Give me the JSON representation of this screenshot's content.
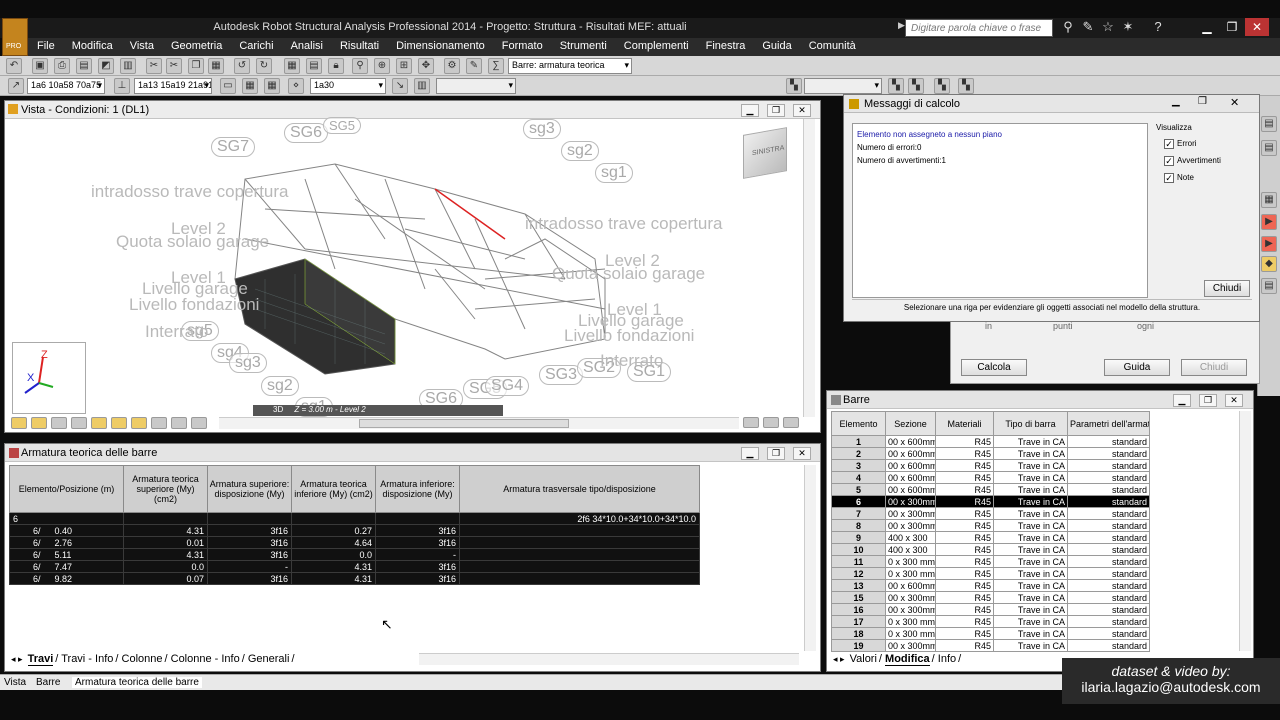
{
  "app": {
    "title": "Autodesk Robot Structural Analysis Professional 2014 - Progetto: Struttura - Risultati MEF: attuali",
    "search_placeholder": "Digitare parola chiave o frase",
    "logo_text": "PRO"
  },
  "menu": [
    "File",
    "Modifica",
    "Vista",
    "Geometria",
    "Carichi",
    "Analisi",
    "Risultati",
    "Dimensionamento",
    "Formato",
    "Strumenti",
    "Complementi",
    "Finestra",
    "Guida",
    "Comunità"
  ],
  "toolbar": {
    "combo_barre": "Barre: armatura teorica",
    "combo_a": "1a6 10a58 70a75 7",
    "combo_b": "1a13 15a19 21a91",
    "combo_c": "1a30"
  },
  "view3d": {
    "title": "Vista - Condizioni: 1 (DL1)",
    "bottom_mode": "3D",
    "bottom_info": "Z = 3.00 m - Level 2",
    "nav_cube": "SINISTRA",
    "labels": [
      "intradosso trave copertura",
      "Level 2",
      "Quota solaio garage",
      "Level 1",
      "Livello garage",
      "Livello fondazioni",
      "Interrato",
      "intradosso trave copertura",
      "Level 2",
      "Quota solaio garage",
      "Level 1",
      "Livello garage",
      "Livello fondazioni",
      "Interrato"
    ],
    "gridpills": [
      "SG7",
      "SG6",
      "SG5",
      "sg3",
      "sg2",
      "sg1",
      "sg5",
      "sg4",
      "sg3",
      "sg2",
      "sg1",
      "SG6",
      "SG5",
      "SG4",
      "SG3",
      "SG2",
      "SG1"
    ]
  },
  "armatura": {
    "title": "Armatura teorica delle barre",
    "headers": [
      "Elemento/Posizione (m)",
      "Armatura teorica superiore (My) (cm2)",
      "Armatura superiore: disposizione (My)",
      "Armatura teorica inferiore (My) (cm2)",
      "Armatura inferiore: disposizione (My)",
      "Armatura trasversale tipo/disposizione"
    ],
    "group_row": {
      "elem": "6",
      "trasv": "2f6 34*10.0+34*10.0+34*10.0"
    },
    "rows": [
      {
        "e": "6/",
        "p": "0.40",
        "s": "4.31",
        "sd": "3f16",
        "i": "0.27",
        "id": "3f16"
      },
      {
        "e": "6/",
        "p": "2.76",
        "s": "0.01",
        "sd": "3f16",
        "i": "4.64",
        "id": "3f16"
      },
      {
        "e": "6/",
        "p": "5.11",
        "s": "4.31",
        "sd": "3f16",
        "i": "0.0",
        "id": "-"
      },
      {
        "e": "6/",
        "p": "7.47",
        "s": "0.0",
        "sd": "-",
        "i": "4.31",
        "id": "3f16"
      },
      {
        "e": "6/",
        "p": "9.82",
        "s": "0.07",
        "sd": "3f16",
        "i": "4.31",
        "id": "3f16"
      }
    ],
    "tabs": [
      "Travi",
      "Travi - Info",
      "Colonne",
      "Colonne - Info",
      "Generali"
    ]
  },
  "barre": {
    "title": "Barre",
    "headers": [
      "Elemento",
      "Sezione",
      "Materiali",
      "Tipo di barra",
      "Parametri dell'armatura"
    ],
    "rows": [
      [
        "1",
        "00 x 600mm",
        "R45",
        "Trave in CA",
        "standard"
      ],
      [
        "2",
        "00 x 600mm",
        "R45",
        "Trave in CA",
        "standard"
      ],
      [
        "3",
        "00 x 600mm",
        "R45",
        "Trave in CA",
        "standard"
      ],
      [
        "4",
        "00 x 600mm",
        "R45",
        "Trave in CA",
        "standard"
      ],
      [
        "5",
        "00 x 600mm",
        "R45",
        "Trave in CA",
        "standard"
      ],
      [
        "6",
        "00 x 300mm",
        "R45",
        "Trave in CA",
        "standard"
      ],
      [
        "7",
        "00 x 300mm",
        "R45",
        "Trave in CA",
        "standard"
      ],
      [
        "8",
        "00 x 300mm",
        "R45",
        "Trave in CA",
        "standard"
      ],
      [
        "9",
        "400 x 300",
        "R45",
        "Trave in CA",
        "standard"
      ],
      [
        "10",
        "400 x 300",
        "R45",
        "Trave in CA",
        "standard"
      ],
      [
        "11",
        "0 x 300 mm",
        "R45",
        "Trave in CA",
        "standard"
      ],
      [
        "12",
        "0 x 300 mm",
        "R45",
        "Trave in CA",
        "standard"
      ],
      [
        "13",
        "00 x 600mm",
        "R45",
        "Trave in CA",
        "standard"
      ],
      [
        "15",
        "00 x 300mm",
        "R45",
        "Trave in CA",
        "standard"
      ],
      [
        "16",
        "00 x 300mm",
        "R45",
        "Trave in CA",
        "standard"
      ],
      [
        "17",
        "0 x 300 mm",
        "R45",
        "Trave in CA",
        "standard"
      ],
      [
        "18",
        "0 x 300 mm",
        "R45",
        "Trave in CA",
        "standard"
      ],
      [
        "19",
        "00 x 300mm",
        "R45",
        "Trave in CA",
        "standard"
      ]
    ],
    "selected_row": "6",
    "tabs": [
      "Valori",
      "Modifica",
      "Info"
    ]
  },
  "dialog": {
    "title": "Messaggi di calcolo",
    "msg1": "Elemento non assegneto a nessun piano",
    "msg2": "Numero di errori:0",
    "msg3": "Numero di avvertimenti:1",
    "vis_label": "Visualizza",
    "checks": [
      "Errori",
      "Avvertimenti",
      "Note"
    ],
    "close": "Chiudi",
    "status": "Selezionare una riga per evidenziare gli oggetti associati nel modello della struttura."
  },
  "dialogBack": {
    "calc": "Calcola",
    "guide": "Guida",
    "close": "Chiudi",
    "frag1": "in",
    "frag2": "punti",
    "frag3": "ogni"
  },
  "status": {
    "tabs": [
      "Vista",
      "Barre",
      "Armatura teorica delle barre"
    ]
  },
  "credit": {
    "line1": "dataset & video by:",
    "line2": "ilaria.lagazio@autodesk.com"
  }
}
